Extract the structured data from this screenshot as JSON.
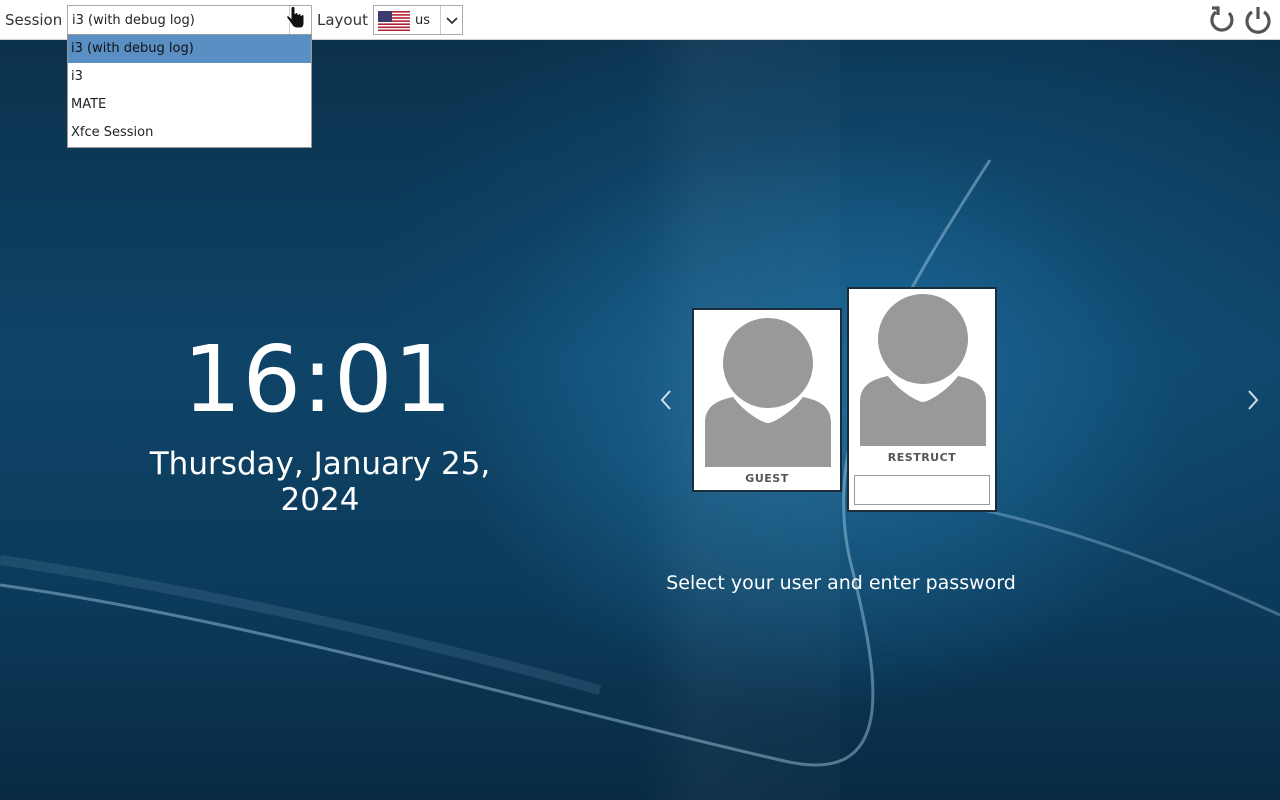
{
  "topbar": {
    "session_label": "Session",
    "session_value": "i3 (with debug log)",
    "layout_label": "Layout",
    "layout_value": "us",
    "layout_flag": "us-flag-icon",
    "reboot_icon": "restart-icon",
    "shutdown_icon": "power-icon"
  },
  "session_options": [
    {
      "label": "i3 (with debug log)",
      "selected": true
    },
    {
      "label": "i3",
      "selected": false
    },
    {
      "label": "MATE",
      "selected": false
    },
    {
      "label": "Xfce Session",
      "selected": false
    }
  ],
  "clock": {
    "time": "16:01",
    "date": "Thursday, January 25, 2024"
  },
  "users": [
    {
      "name": "GUEST",
      "active": false
    },
    {
      "name": "RESTRUCT",
      "active": true,
      "password": ""
    }
  ],
  "hint": "Select your user and enter password",
  "colors": {
    "accent_selected": "#5a8fc4",
    "avatar": "#999999",
    "background": "#0e4468"
  }
}
